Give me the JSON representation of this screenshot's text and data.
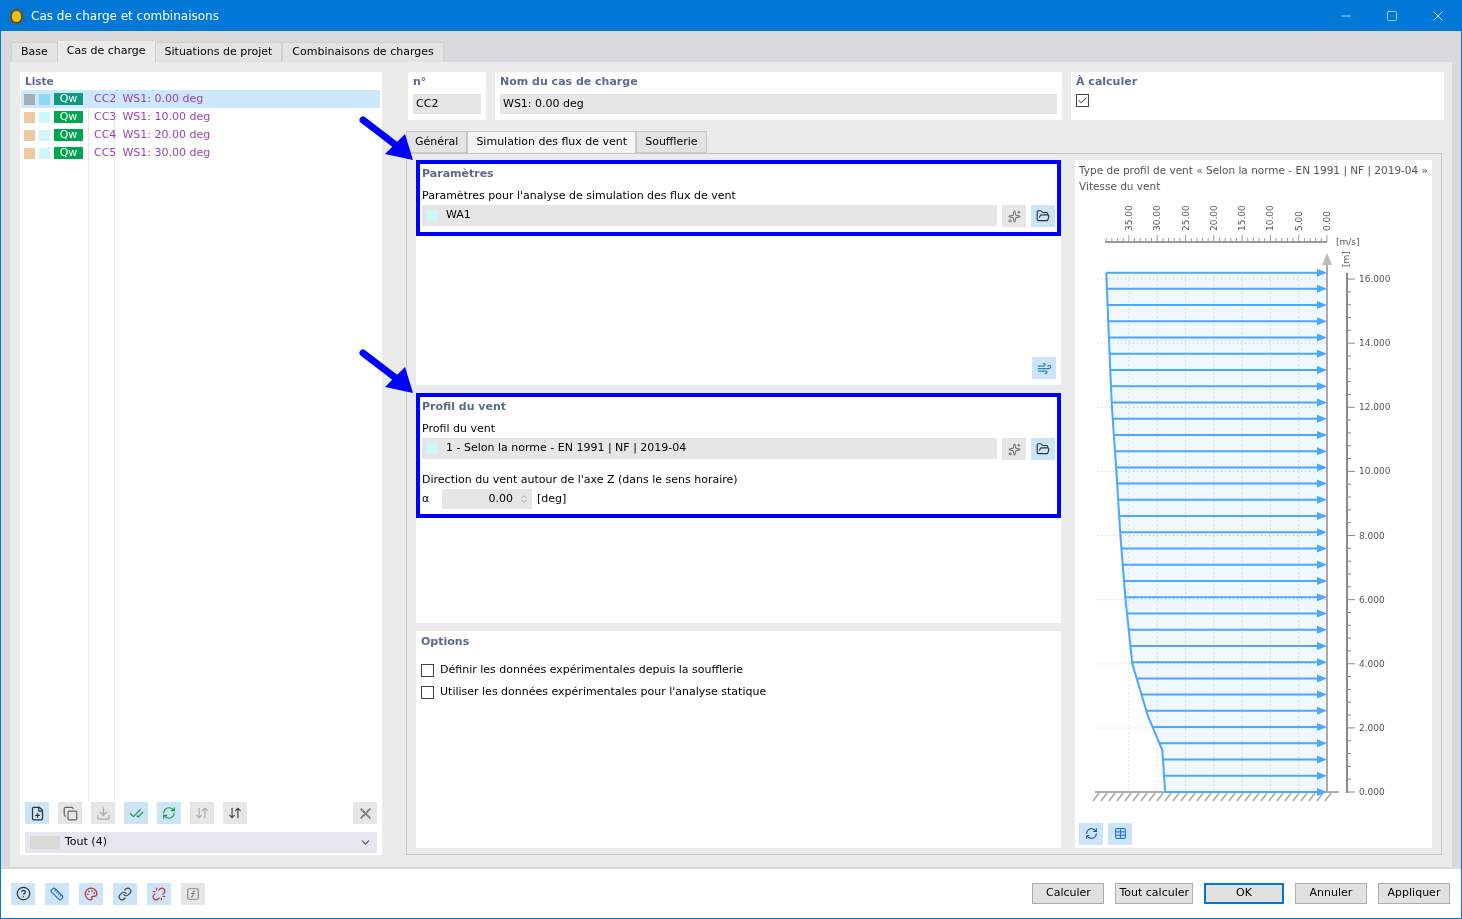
{
  "window": {
    "title": "Cas de charge et combinaisons"
  },
  "tabs": [
    {
      "label": "Base",
      "selected": false
    },
    {
      "label": "Cas de charge",
      "selected": true
    },
    {
      "label": "Situations de projet",
      "selected": false
    },
    {
      "label": "Combinaisons de charges",
      "selected": false
    }
  ],
  "list": {
    "title": "Liste",
    "items": [
      {
        "swatches": [
          {
            "color": "#a7aeb3"
          },
          {
            "color": "#90d4f4"
          }
        ],
        "badge": "Qw",
        "id": "CC2",
        "name": "WS1: 0.00 deg",
        "selected": true
      },
      {
        "swatches": [
          {
            "color": "#f0c8a0"
          },
          {
            "color": "#ccf8fa"
          }
        ],
        "badge": "Qw",
        "id": "CC3",
        "name": "WS1: 10.00 deg",
        "selected": false
      },
      {
        "swatches": [
          {
            "color": "#f0c8a0"
          },
          {
            "color": "#ccf8fa"
          }
        ],
        "badge": "Qw",
        "id": "CC4",
        "name": "WS1: 20.00 deg",
        "selected": false
      },
      {
        "swatches": [
          {
            "color": "#f0c8a0"
          },
          {
            "color": "#ccf8fa"
          }
        ],
        "badge": "Qw",
        "id": "CC5",
        "name": "WS1: 30.00 deg",
        "selected": false
      }
    ],
    "filter": "Tout (4)"
  },
  "number": {
    "label": "n°",
    "value": "CC2"
  },
  "load_case_name": {
    "label": "Nom du cas de charge",
    "value": "WS1: 0.00 deg"
  },
  "to_calculate": {
    "label": "À calculer",
    "checked": true
  },
  "sub_tabs": [
    {
      "label": "Général",
      "selected": false
    },
    {
      "label": "Simulation des flux de vent",
      "selected": true
    },
    {
      "label": "Soufflerie",
      "selected": false
    }
  ],
  "parameters": {
    "title": "Paramètres",
    "field_label": "Paramètres pour l'analyse de simulation des flux de vent",
    "value": "WA1",
    "color": "#ccf8fa",
    "highlighted": true
  },
  "wind_profile": {
    "title": "Profil du vent",
    "field_label": "Profil du vent",
    "value": "1 - Selon la norme - EN 1991 | NF | 2019-04",
    "color": "#ccf8fa",
    "direction_label": "Direction du vent autour de l'axe Z (dans le sens horaire)",
    "symbol": "α",
    "angle": "0.00",
    "unit": "[deg]",
    "highlighted": true
  },
  "options": {
    "title": "Options",
    "items": [
      {
        "label": "Définir les données expérimentales depuis la soufflerie",
        "checked": false
      },
      {
        "label": "Utiliser les données expérimentales pour l'analyse statique",
        "checked": false
      }
    ]
  },
  "chart_panel": {
    "caption": "Type de profil de vent « Selon la norme - EN 1991 | NF | 2019-04 »",
    "chart_data": {
      "type": "line",
      "title": "Vitesse du vent",
      "xlabel": "[m/s]",
      "ylabel": "[m]",
      "grid": true,
      "x": [
        28.6,
        29.1,
        31.7,
        34.4,
        35.6,
        36.5,
        37.2,
        38.0,
        38.5,
        39.0
      ],
      "series": [
        {
          "color": "#4da6ff",
          "values": [
            0,
            1.3,
            2.4,
            4,
            6,
            8,
            10,
            12,
            14,
            16.2
          ]
        }
      ],
      "xlim": [
        39.2,
        0
      ],
      "ylim": [
        0,
        16.2
      ],
      "xticks": [
        {
          "value": 35,
          "label": "35.00"
        },
        {
          "value": 30,
          "label": "30.00"
        },
        {
          "value": 25,
          "label": "25.00"
        },
        {
          "value": 20,
          "label": "20.00"
        },
        {
          "value": 15,
          "label": "15.00"
        },
        {
          "value": 10,
          "label": "10.00"
        },
        {
          "value": 5,
          "label": "5.00"
        },
        {
          "value": 0,
          "label": "0.00"
        }
      ],
      "yticks": [
        {
          "value": 16,
          "label": "16.000"
        },
        {
          "value": 14,
          "label": "14.000"
        },
        {
          "value": 12,
          "label": "12.000"
        },
        {
          "value": 10,
          "label": "10.000"
        },
        {
          "value": 8,
          "label": "8.000"
        },
        {
          "value": 6,
          "label": "6.000"
        },
        {
          "value": 4,
          "label": "4.000"
        },
        {
          "value": 2,
          "label": "2.000"
        },
        {
          "value": 0,
          "label": "0.000"
        }
      ]
    }
  },
  "buttons": [
    {
      "label": "Calculer",
      "default": false
    },
    {
      "label": "Tout calculer",
      "default": false
    },
    {
      "label": "OK",
      "default": true
    },
    {
      "label": "Annuler",
      "default": false
    },
    {
      "label": "Appliquer",
      "default": false
    }
  ]
}
